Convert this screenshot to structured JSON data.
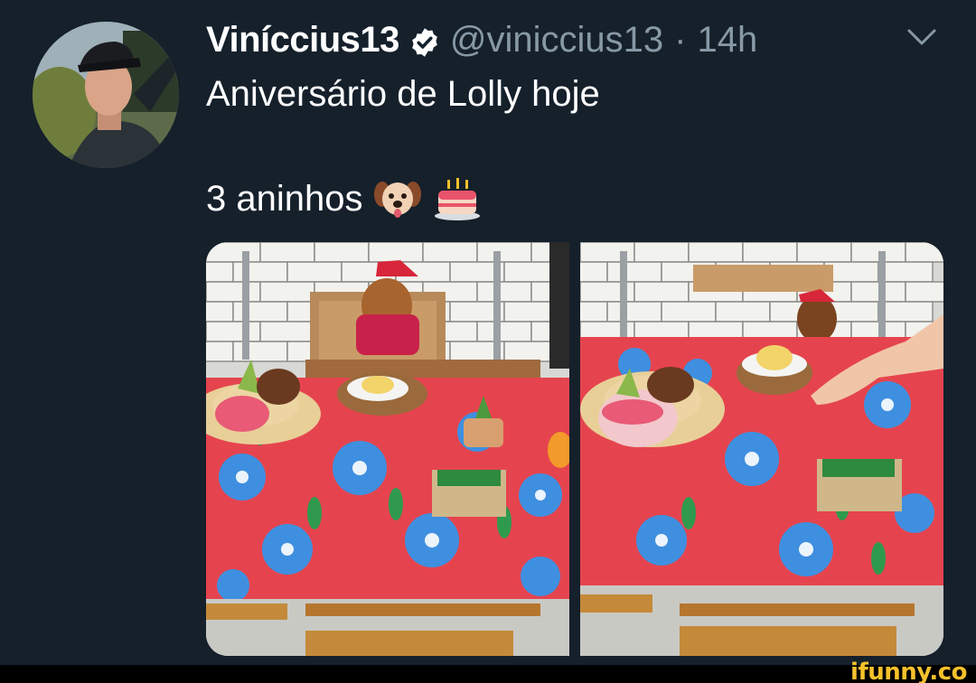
{
  "tweet": {
    "display_name": "Viníccius13",
    "handle": "@viniccius13",
    "separator": "·",
    "timestamp": "14h",
    "text_line_1": "Aniversário de Lolly hoje",
    "text_line_2": "3 aninhos",
    "emojis": [
      "dog-face-emoji",
      "birthday-cake-emoji"
    ]
  },
  "icons": {
    "verified": "verified-badge-icon",
    "more": "chevron-down-icon"
  },
  "colors": {
    "background": "#15202b",
    "secondary_text": "#8899a6",
    "primary_text": "#ffffff",
    "watermark": "#f6c12b"
  },
  "watermark": "ifunny.co"
}
